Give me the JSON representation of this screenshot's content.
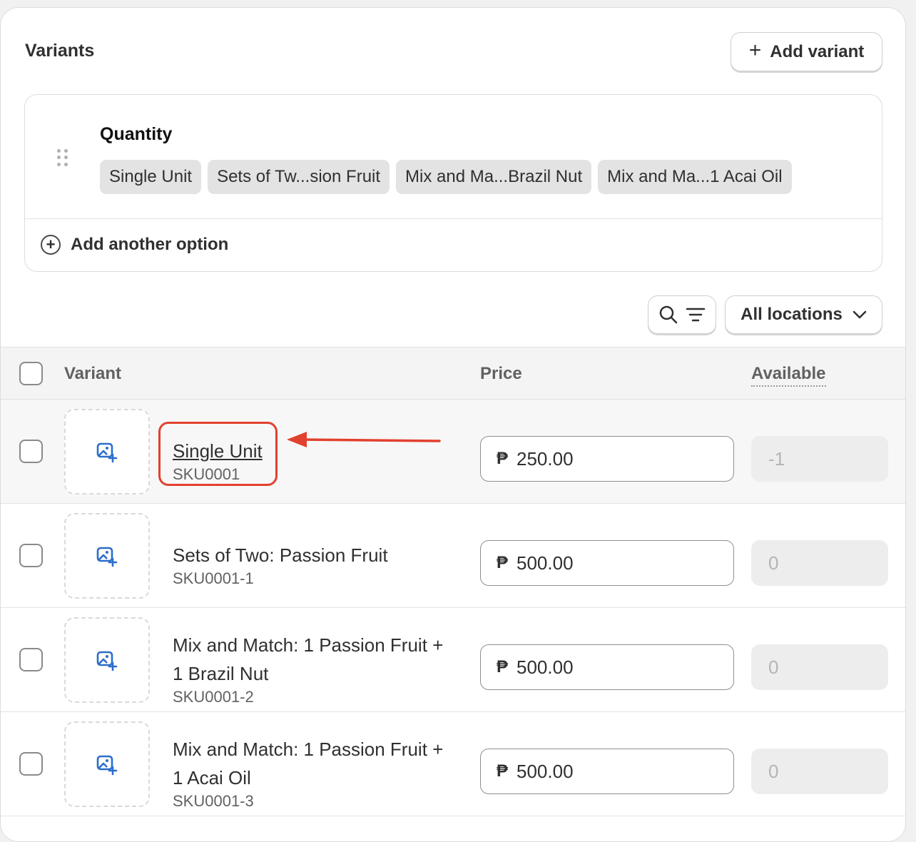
{
  "card": {
    "title": "Variants",
    "add_variant_label": "Add variant"
  },
  "options": {
    "name": "Quantity",
    "values": [
      "Single Unit",
      "Sets of Tw...sion Fruit",
      "Mix and Ma...Brazil Nut",
      "Mix and Ma...1 Acai Oil"
    ],
    "add_option_label": "Add another option"
  },
  "toolbar": {
    "locations_label": "All locations"
  },
  "table": {
    "headers": {
      "variant": "Variant",
      "price": "Price",
      "available": "Available"
    },
    "rows": [
      {
        "title_line1": "Single Unit",
        "title_line2": "",
        "sku": "SKU0001",
        "currency": "₱",
        "price": "250.00",
        "available": "-1"
      },
      {
        "title_line1": "Sets of Two: Passion Fruit",
        "title_line2": "",
        "sku": "SKU0001-1",
        "currency": "₱",
        "price": "500.00",
        "available": "0"
      },
      {
        "title_line1": "Mix and Match: 1 Passion Fruit +",
        "title_line2": "1 Brazil Nut",
        "sku": "SKU0001-2",
        "currency": "₱",
        "price": "500.00",
        "available": "0"
      },
      {
        "title_line1": "Mix and Match: 1 Passion Fruit +",
        "title_line2": "1 Acai Oil",
        "sku": "SKU0001-3",
        "currency": "₱",
        "price": "500.00",
        "available": "0"
      }
    ]
  },
  "annotation": {
    "color": "#e2412f"
  }
}
